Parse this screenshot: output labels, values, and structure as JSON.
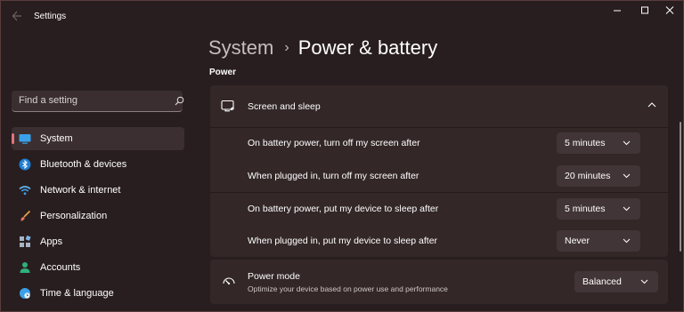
{
  "window": {
    "app_title": "Settings"
  },
  "search": {
    "placeholder": "Find a setting"
  },
  "sidebar": {
    "items": [
      {
        "label": "System",
        "icon": "monitor-icon",
        "active": true
      },
      {
        "label": "Bluetooth & devices",
        "icon": "bluetooth-icon"
      },
      {
        "label": "Network & internet",
        "icon": "wifi-icon"
      },
      {
        "label": "Personalization",
        "icon": "brush-icon"
      },
      {
        "label": "Apps",
        "icon": "apps-icon"
      },
      {
        "label": "Accounts",
        "icon": "person-icon"
      },
      {
        "label": "Time & language",
        "icon": "globe-clock-icon"
      }
    ]
  },
  "header": {
    "breadcrumb_parent": "System",
    "breadcrumb_separator": "›",
    "page_title": "Power & battery",
    "section_title": "Power"
  },
  "screen_sleep": {
    "title": "Screen and sleep",
    "rows": [
      {
        "label": "On battery power, turn off my screen after",
        "value": "5 minutes"
      },
      {
        "label": "When plugged in, turn off my screen after",
        "value": "20 minutes"
      },
      {
        "label": "On battery power, put my device to sleep after",
        "value": "5 minutes"
      },
      {
        "label": "When plugged in, put my device to sleep after",
        "value": "Never"
      }
    ]
  },
  "power_mode": {
    "title": "Power mode",
    "description": "Optimize your device based on power use and performance",
    "value": "Balanced"
  },
  "colors": {
    "accent": "#e3737b",
    "background": "#281e1f",
    "card": "#332728",
    "dropdown": "#423537"
  }
}
